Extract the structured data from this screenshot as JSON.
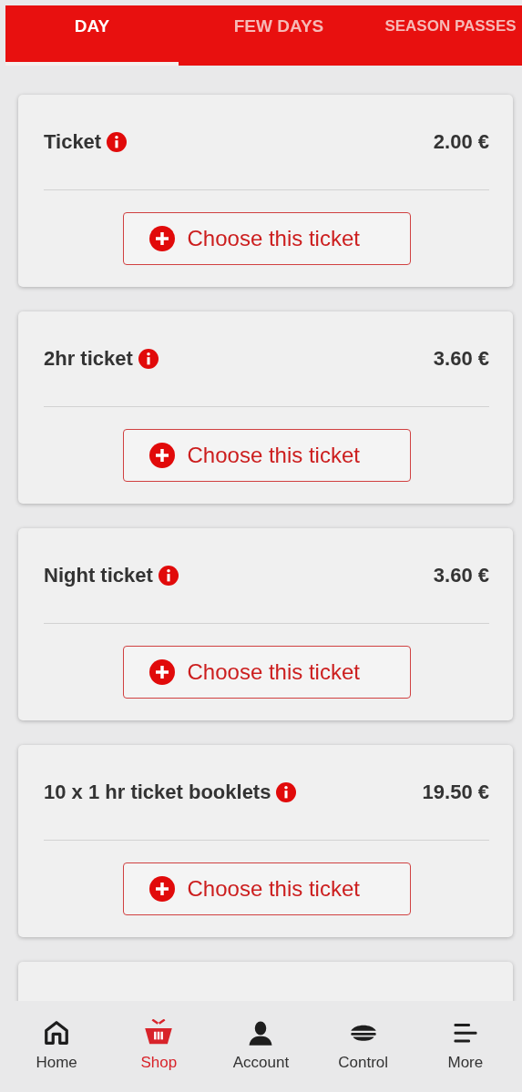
{
  "tabs": [
    {
      "label": "DAY",
      "selected": true
    },
    {
      "label": "FEW DAYS",
      "selected": false
    },
    {
      "label": "SEASON PASSES",
      "selected": false
    }
  ],
  "tickets": [
    {
      "name": "Ticket",
      "price": "2.00 €",
      "button": "Choose this ticket"
    },
    {
      "name": "2hr ticket",
      "price": "3.60 €",
      "button": "Choose this ticket"
    },
    {
      "name": "Night ticket",
      "price": "3.60 €",
      "button": "Choose this ticket"
    },
    {
      "name": "10 x 1 hr ticket booklets",
      "price": "19.50 €",
      "button": "Choose this ticket"
    }
  ],
  "bottom_nav": [
    {
      "label": "Home",
      "selected": false
    },
    {
      "label": "Shop",
      "selected": true
    },
    {
      "label": "Account",
      "selected": false
    },
    {
      "label": "Control",
      "selected": false
    },
    {
      "label": "More",
      "selected": false
    }
  ]
}
